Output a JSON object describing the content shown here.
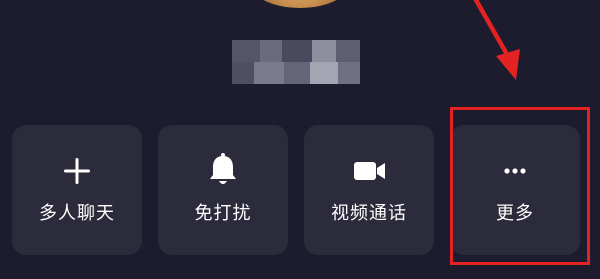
{
  "actions": [
    {
      "label": "多人聊天",
      "icon": "plus-icon"
    },
    {
      "label": "免打扰",
      "icon": "bell-icon"
    },
    {
      "label": "视频通话",
      "icon": "video-camera-icon"
    },
    {
      "label": "更多",
      "icon": "more-dots-icon"
    }
  ],
  "annotation_color": "#e52222",
  "card_color": "#2b2b3b",
  "background_color": "#1d1c2e"
}
